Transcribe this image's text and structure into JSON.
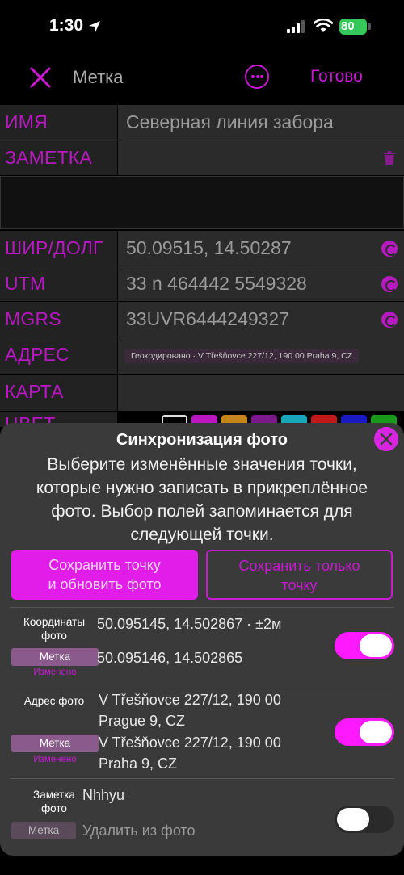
{
  "status_bar": {
    "time": "1:30",
    "battery": "80"
  },
  "nav": {
    "title": "Метка",
    "done_label": "Готово"
  },
  "form": {
    "name_label": "ИМЯ",
    "name_value": "Северная линия забора",
    "note_label": "ЗАМЕТКА",
    "latlon_label": "ШИР/ДОЛГ",
    "latlon_value": "50.09515, 14.50287",
    "utm_label": "UTM",
    "utm_value": "33 n 464442 5549328",
    "mgrs_label": "MGRS",
    "mgrs_value": "33UVR6444249327",
    "address_label": "АДРЕС",
    "address_chip": "Геокодировано · V Třešňovce 227/12, 190 00 Praha 9, CZ",
    "map_label": "КАРТА",
    "color_label": "ЦВЕТ",
    "colors": [
      "#000000",
      "#b817c2",
      "#c7831c",
      "#7a1a8a",
      "#1aa6b8",
      "#c21a1a",
      "#1a1ac2",
      "#1a9a1a"
    ]
  },
  "modal": {
    "title": "Синхронизация фото",
    "description": "Выберите изменённые значения точки, которые нужно записать в прикреплённое фото. Выбор полей запоминается для следующей точки.",
    "primary_button_line1": "Сохранить точку",
    "primary_button_line2": "и обновить фото",
    "secondary_button_line1": "Сохранить только",
    "secondary_button_line2": "точку",
    "rows": [
      {
        "label_line1": "Координаты",
        "label_line2": "фото",
        "photo_value": "50.095145, 14.502867 · ±2м",
        "chip": "Метка",
        "changed": "Изменено",
        "point_value": "50.095146, 14.502865",
        "toggle": "on"
      },
      {
        "label_line1": "Адрес фото",
        "photo_value_line1": "V Třešňovce 227/12, 190 00",
        "photo_value_line2": "Prague 9, CZ",
        "chip": "Метка",
        "changed": "Изменено",
        "point_value_line1": "V Třešňovce 227/12, 190 00",
        "point_value_line2": "Praha 9, CZ",
        "toggle": "on"
      },
      {
        "label_line1": "Заметка",
        "label_line2": "фото",
        "photo_value": "Nhhyu",
        "chip": "Метка",
        "point_value": "Удалить из фото",
        "toggle": "off"
      }
    ]
  }
}
